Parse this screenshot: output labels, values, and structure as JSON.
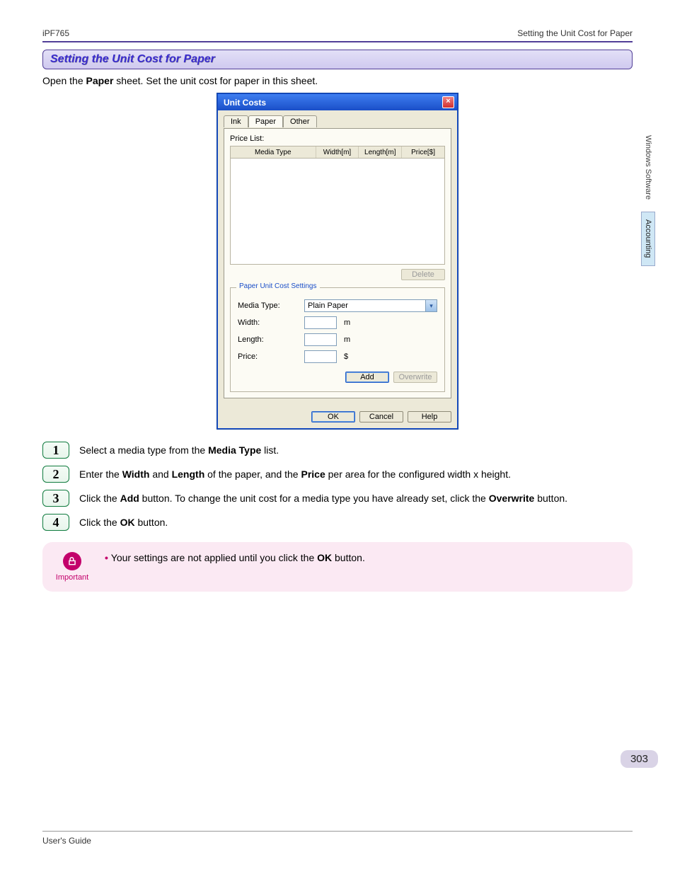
{
  "header": {
    "left": "iPF765",
    "right": "Setting the Unit Cost for Paper"
  },
  "section_title": "Setting the Unit Cost for Paper",
  "intro": {
    "pre": "Open the ",
    "b1": "Paper",
    "post": " sheet. Set the unit cost for paper in this sheet."
  },
  "side_tabs": {
    "t1": "Windows Software",
    "t2": "Accounting"
  },
  "dialog": {
    "title": "Unit Costs",
    "tabs": {
      "ink": "Ink",
      "paper": "Paper",
      "other": "Other"
    },
    "price_list_label": "Price List:",
    "columns": {
      "media": "Media Type",
      "width": "Width[m]",
      "length": "Length[m]",
      "price": "Price[$]"
    },
    "delete_btn": "Delete",
    "legend": "Paper Unit Cost Settings",
    "media_type_label": "Media Type:",
    "media_type_value": "Plain Paper",
    "width_label": "Width:",
    "width_unit": "m",
    "length_label": "Length:",
    "length_unit": "m",
    "price_label": "Price:",
    "price_unit": "$",
    "add_btn": "Add",
    "overwrite_btn": "Overwrite",
    "ok_btn": "OK",
    "cancel_btn": "Cancel",
    "help_btn": "Help"
  },
  "steps": {
    "s1": {
      "n": "1",
      "pre": "Select a media type from the ",
      "b1": "Media Type",
      "post": " list."
    },
    "s2": {
      "n": "2",
      "pre": "Enter the ",
      "b1": "Width",
      "mid1": " and ",
      "b2": "Length",
      "mid2": " of the paper, and the ",
      "b3": "Price",
      "post": " per area for the configured width x height."
    },
    "s3": {
      "n": "3",
      "pre": "Click the ",
      "b1": "Add",
      "mid1": " button. To change the unit cost for a media type you have already set, click the ",
      "b2": "Overwrite",
      "post": " button."
    },
    "s4": {
      "n": "4",
      "pre": "Click the ",
      "b1": "OK",
      "post": " button."
    }
  },
  "important": {
    "label": "Important",
    "text_pre": "Your settings are not applied until you click the ",
    "text_b": "OK",
    "text_post": " button."
  },
  "page_number": "303",
  "footer": "User's Guide"
}
